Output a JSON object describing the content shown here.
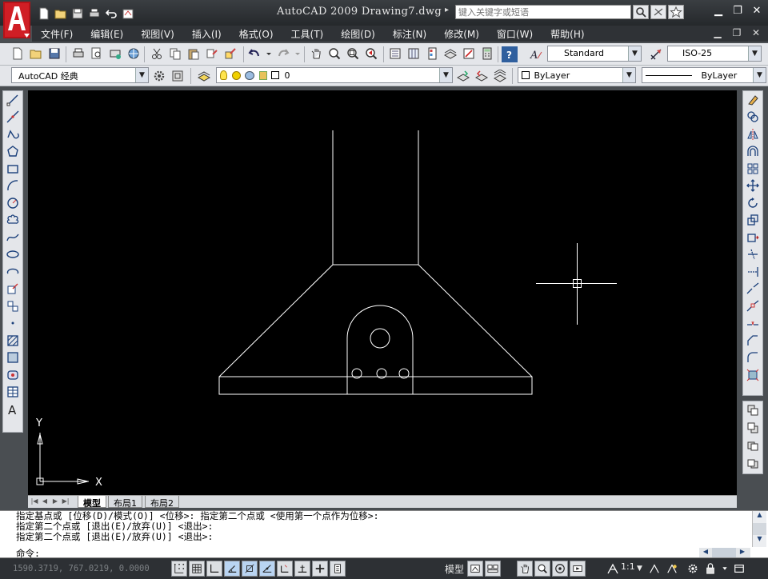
{
  "window": {
    "title": "AutoCAD 2009  Drawing7.dwg",
    "search_placeholder": "键入关键字或短语"
  },
  "menu": [
    {
      "label": "文件(F)"
    },
    {
      "label": "编辑(E)"
    },
    {
      "label": "视图(V)"
    },
    {
      "label": "插入(I)"
    },
    {
      "label": "格式(O)"
    },
    {
      "label": "工具(T)"
    },
    {
      "label": "绘图(D)"
    },
    {
      "label": "标注(N)"
    },
    {
      "label": "修改(M)"
    },
    {
      "label": "窗口(W)"
    },
    {
      "label": "帮助(H)"
    }
  ],
  "toolbar": {
    "text_style": "Standard",
    "dim_style": "ISO-25",
    "workspace": "AutoCAD 经典",
    "layer": "0",
    "color": "ByLayer",
    "linetype": "ByLayer"
  },
  "ucs": {
    "x_label": "X",
    "y_label": "Y"
  },
  "layout_tabs": [
    {
      "label": "模型",
      "active": true
    },
    {
      "label": "布局1",
      "active": false
    },
    {
      "label": "布局2",
      "active": false
    }
  ],
  "command": {
    "history": [
      "指定基点或 [位移(D)/模式(O)] <位移>: 指定第二个点或 <使用第一个点作为位移>:",
      "指定第二个点或 [退出(E)/放弃(U)] <退出>:",
      "指定第二个点或 [退出(E)/放弃(U)] <退出>:"
    ],
    "prompt": "命令:",
    "current_input": ""
  },
  "status": {
    "coords": "1590.3719, 767.0219, 0.0000",
    "model_label": "模型",
    "annotation_scale": "1:1"
  },
  "colors": {
    "canvas": "#000000",
    "geometry": "#ffffff",
    "title_bg": "#2f3236",
    "logo_red": "#c4161c"
  }
}
